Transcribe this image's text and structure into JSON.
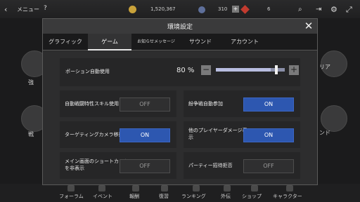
{
  "background": {
    "top_bar": {
      "back_icon": "back-arrow-icon",
      "menu_label": "メニュー",
      "help_icon": "question-icon",
      "gold": "1,520,367",
      "crystal": "310",
      "ruby": "6",
      "right_icons": [
        "search-icon",
        "exit-icon",
        "gear-icon",
        "expand-icon"
      ]
    },
    "left_labels": [
      "強",
      "戦"
    ],
    "right_labels": [
      "リア",
      "ンド"
    ],
    "bottom_tabs": [
      "フォーラム",
      "イベント",
      "報酬",
      "復習",
      "ランキング",
      "外伝",
      "ショップ",
      "キャラクター"
    ]
  },
  "dialog": {
    "title": "環境設定",
    "close_icon": "close-icon",
    "tabs": [
      {
        "label": "グラフィック",
        "active": false
      },
      {
        "label": "ゲーム",
        "active": true
      },
      {
        "label": "お知らせメッセージ",
        "active": false
      },
      {
        "label": "サウンド",
        "active": false
      },
      {
        "label": "アカウント",
        "active": false
      }
    ],
    "potion": {
      "label": "ポーション自動使用",
      "value_text": "80 %",
      "level": 0.8,
      "minus": "−",
      "plus": "+"
    },
    "options": [
      {
        "label": "自動戦闘特性スキル使用",
        "state": "OFF"
      },
      {
        "label": "紛争戦自動参加",
        "state": "ON"
      },
      {
        "label": "ターゲティングカメラ移動",
        "state": "ON"
      },
      {
        "label": "他のプレイヤーダメージ表示",
        "state": "ON"
      },
      {
        "label": "メイン画面のショートカット\nを非表示",
        "state": "OFF"
      },
      {
        "label": "パーティー招待拒否",
        "state": "OFF"
      }
    ],
    "colors": {
      "on": "#2d57b0",
      "off": "#2f2f30"
    }
  }
}
